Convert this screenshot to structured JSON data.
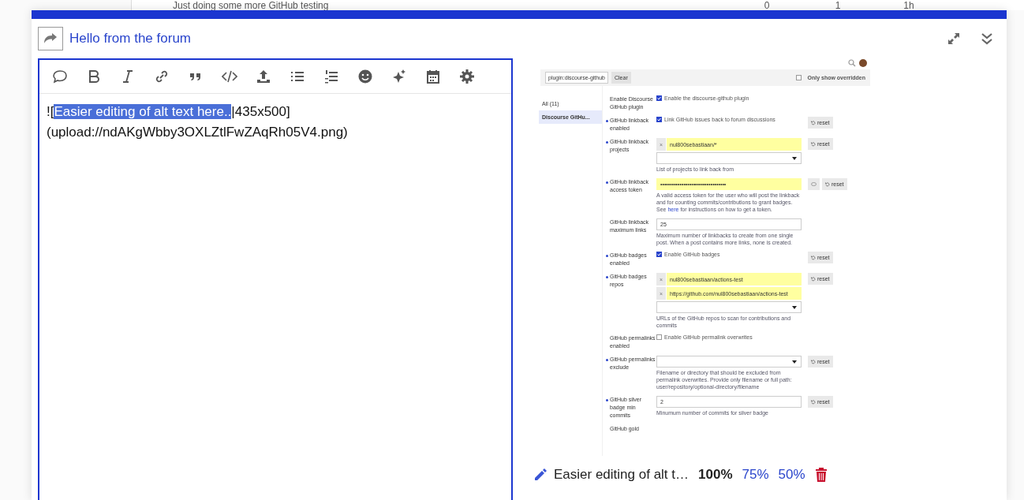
{
  "background_topic": {
    "title": "Just doing some more GitHub testing",
    "columns": [
      "0",
      "1",
      "1h"
    ]
  },
  "composer": {
    "title": "Hello from the forum",
    "editor": {
      "text_before": "![",
      "selection": "Easier editing of alt text here..",
      "text_after": "|435x500]",
      "line_2": "(upload://ndAKgWbby3OXLZtlFwZAqRh05V4.png)"
    },
    "preview": {
      "screenshot": {
        "filter_value": "plugin:discourse-github",
        "clear_button": "Clear",
        "only_overridden": {
          "label": "Only show overridden",
          "checked": false
        },
        "categories": [
          {
            "label": "All",
            "count": "(11)",
            "selected": false
          },
          {
            "label": "Discourse GitHu...",
            "selected": true
          }
        ],
        "settings": [
          {
            "label": "Enable Discourse GitHub plugin",
            "overridden": false,
            "kind": "checkbox",
            "checked": true,
            "text": "Enable the discourse-github plugin"
          },
          {
            "label": "GitHub linkback enabled",
            "overridden": true,
            "kind": "checkbox",
            "checked": true,
            "text": "Link GitHub issues back to forum discussions",
            "reset": "reset"
          },
          {
            "label": "GitHub linkback projects",
            "overridden": true,
            "kind": "list",
            "values": [
              {
                "value": "nul800sebastiaan/*",
                "remove": "×"
              }
            ],
            "description": "List of projects to link back from",
            "reset": "reset"
          },
          {
            "label": "GitHub linkback access token",
            "overridden": true,
            "kind": "secret",
            "value": "••••••••••••••••••••••••••••••••••",
            "description": "A valid access token for the user who will post the linkback and for counting commits/contributions to grant badges. See",
            "link": "here",
            "description_end": "for instructions on how to get a token.",
            "reset": "reset"
          },
          {
            "label": "GitHub linkback maximum links",
            "overridden": false,
            "kind": "text",
            "value": "25",
            "description": "Maximum number of linkbacks to create from one single post. When a post contains more links, none is created."
          },
          {
            "label": "GitHub badges enabled",
            "overridden": true,
            "kind": "checkbox",
            "checked": true,
            "text": "Enable GitHub badges",
            "reset": "reset"
          },
          {
            "label": "GitHub badges repos",
            "overridden": true,
            "kind": "list",
            "values": [
              {
                "value": "nul800sebastiaan/actions-test",
                "remove": "×"
              },
              {
                "value": "https://github.com/nul800sebastiaan/actions-test",
                "remove": "×"
              }
            ],
            "description": "URLs of the GitHub repos to scan for contributions and commits",
            "reset": "reset"
          },
          {
            "label": "GitHub permalinks enabled",
            "overridden": false,
            "kind": "checkbox",
            "checked": false,
            "text": "Enable GitHub permalink overwrites"
          },
          {
            "label": "GitHub permalinks exclude",
            "overridden": true,
            "kind": "list",
            "description": "Filename or directory that should be excluded from permalink overwrites. Provide only filename or full path: user/repository/optional-directory/filename",
            "reset": "reset"
          },
          {
            "label": "GitHub silver badge min commits",
            "overridden": true,
            "kind": "text",
            "value": "2",
            "description": "Minumum number of commits for silver badge",
            "reset": "reset"
          },
          {
            "label": "GitHub gold",
            "overridden": false,
            "kind": "text"
          }
        ]
      },
      "alt_text": "Easier editing of alt t…",
      "scales": [
        {
          "label": "100%",
          "selected": true
        },
        {
          "label": "75%",
          "selected": false
        },
        {
          "label": "50%",
          "selected": false
        }
      ]
    }
  }
}
